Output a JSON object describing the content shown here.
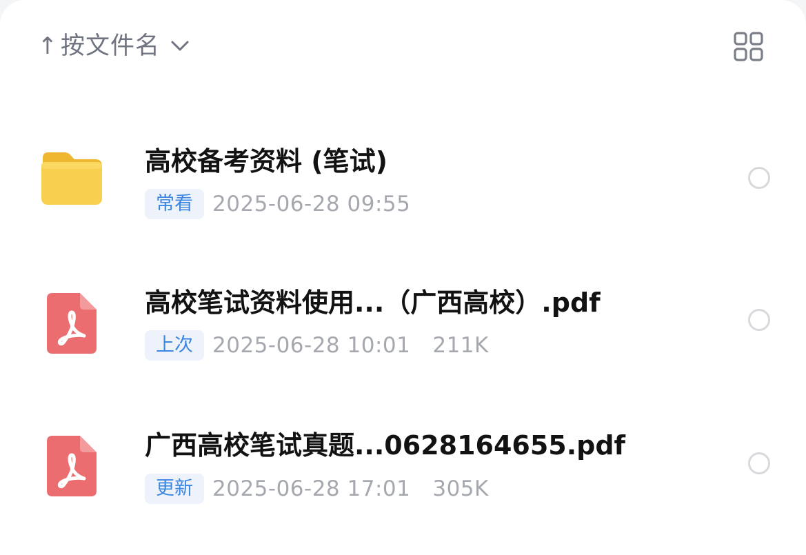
{
  "sort": {
    "arrow": "↑",
    "label": "按文件名",
    "chevron_icon": "chevron-down-icon"
  },
  "view_toggle_icon": "grid-view-icon",
  "colors": {
    "tag_text": "#3a86e0",
    "tag_bg": "#eef3fb",
    "folder": "#f7c842",
    "pdf": "#ec6d70",
    "meta_text": "#a5a8ae"
  },
  "files": [
    {
      "type": "folder",
      "icon": "folder-icon",
      "name": "高校备考资料 (笔试)",
      "tag": "常看",
      "date": "2025-06-28 09:55",
      "size": ""
    },
    {
      "type": "pdf",
      "icon": "pdf-icon",
      "name": "高校笔试资料使用...（广西高校）.pdf",
      "tag": "上次",
      "date": "2025-06-28 10:01",
      "size": "211K"
    },
    {
      "type": "pdf",
      "icon": "pdf-icon",
      "name": "广西高校笔试真题...0628164655.pdf",
      "tag": "更新",
      "date": "2025-06-28 17:01",
      "size": "305K"
    }
  ]
}
